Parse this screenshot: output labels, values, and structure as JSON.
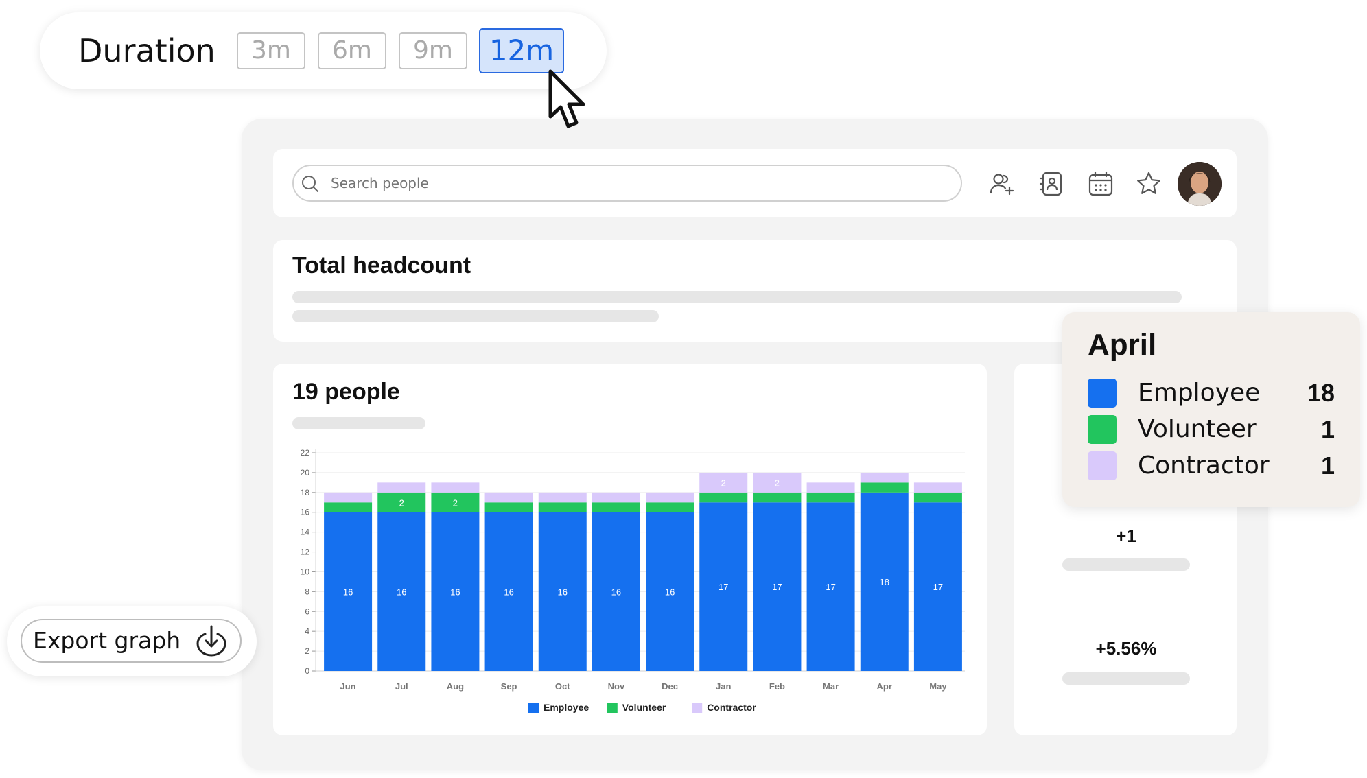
{
  "duration": {
    "label": "Duration",
    "options": [
      "3m",
      "6m",
      "9m",
      "12m"
    ],
    "selected": "12m"
  },
  "search": {
    "placeholder": "Search people"
  },
  "toolbar": {
    "icons": [
      "add-person-icon",
      "contact-card-icon",
      "calendar-icon",
      "star-icon"
    ]
  },
  "headcount": {
    "title": "Total headcount"
  },
  "chart_card": {
    "title": "19 people"
  },
  "side_stats": {
    "change": "+1",
    "percent": "+5.56%"
  },
  "tooltip": {
    "title": "April",
    "rows": [
      {
        "label": "Employee",
        "value": "18",
        "color": "#1570ef"
      },
      {
        "label": "Volunteer",
        "value": "1",
        "color": "#22c55e"
      },
      {
        "label": "Contractor",
        "value": "1",
        "color": "#d9c9fb"
      }
    ]
  },
  "export": {
    "label": "Export graph"
  },
  "colors": {
    "employee": "#1570ef",
    "volunteer": "#22c55e",
    "contractor": "#d9c9fb",
    "accent": "#1864e0"
  },
  "chart_data": {
    "type": "bar",
    "stacked": true,
    "categories": [
      "Jun",
      "Jul",
      "Aug",
      "Sep",
      "Oct",
      "Nov",
      "Dec",
      "Jan",
      "Feb",
      "Mar",
      "Apr",
      "May"
    ],
    "series": [
      {
        "name": "Employee",
        "values": [
          16,
          16,
          16,
          16,
          16,
          16,
          16,
          17,
          17,
          17,
          18,
          17
        ]
      },
      {
        "name": "Volunteer",
        "values": [
          1,
          2,
          2,
          1,
          1,
          1,
          1,
          1,
          1,
          1,
          1,
          1
        ]
      },
      {
        "name": "Contractor",
        "values": [
          1,
          1,
          1,
          1,
          1,
          1,
          1,
          2,
          2,
          1,
          1,
          1
        ]
      }
    ],
    "ylim": [
      0,
      22
    ],
    "yticks": [
      0,
      2,
      4,
      6,
      8,
      10,
      12,
      14,
      16,
      18,
      20,
      22
    ],
    "grid": true,
    "legend": "bottom"
  }
}
